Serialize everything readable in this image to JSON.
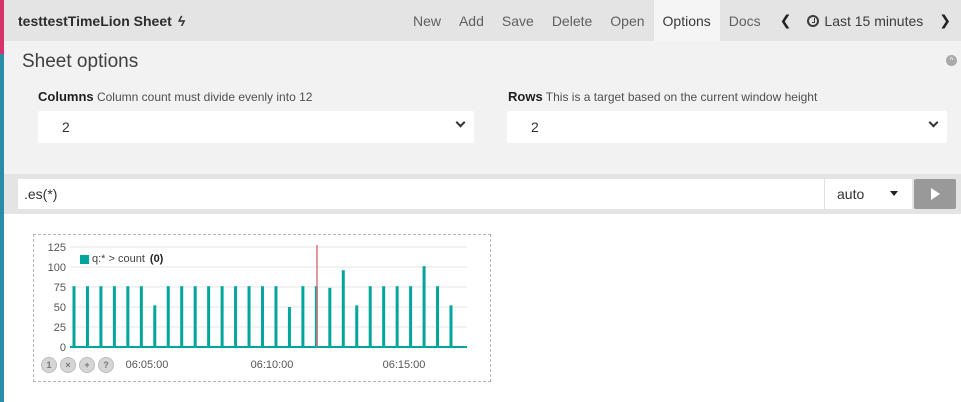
{
  "topnav": {
    "title": "testtestTimeLion Sheet",
    "bolt_icon": "bolt-icon",
    "items": [
      {
        "label": "New"
      },
      {
        "label": "Add"
      },
      {
        "label": "Save"
      },
      {
        "label": "Delete"
      },
      {
        "label": "Open"
      },
      {
        "label": "Options",
        "active": true
      },
      {
        "label": "Docs"
      }
    ],
    "time_range": "Last 15 minutes"
  },
  "options": {
    "title": "Sheet options",
    "columns": {
      "label": "Columns",
      "help": "Column count must divide evenly into 12",
      "value": "2"
    },
    "rows": {
      "label": "Rows",
      "help": "This is a target based on the current window height",
      "value": "2"
    }
  },
  "expression": {
    "value": ".es(*)",
    "interval": "auto"
  },
  "colors": {
    "series": "#00a69b",
    "cursor": "#d47784",
    "accent_pink": "#d6336c",
    "accent_teal": "#2a8ca8"
  },
  "chart_data": {
    "type": "bar",
    "legend": {
      "label": "q:* > count",
      "value": "(0)"
    },
    "yticks": [
      "125",
      "100",
      "75",
      "50",
      "25",
      "0"
    ],
    "ylim": [
      0,
      125
    ],
    "xticks": [
      "06:05:00",
      "06:10:00",
      "06:15:00"
    ],
    "grid": true,
    "bar_values": [
      76,
      76,
      76,
      76,
      76,
      76,
      52,
      76,
      76,
      76,
      76,
      76,
      76,
      76,
      76,
      76,
      50,
      76,
      76,
      74,
      96,
      52,
      76,
      76,
      76,
      76,
      101,
      76,
      52
    ]
  },
  "panel_buttons": [
    "1",
    "×",
    "+",
    "?"
  ]
}
